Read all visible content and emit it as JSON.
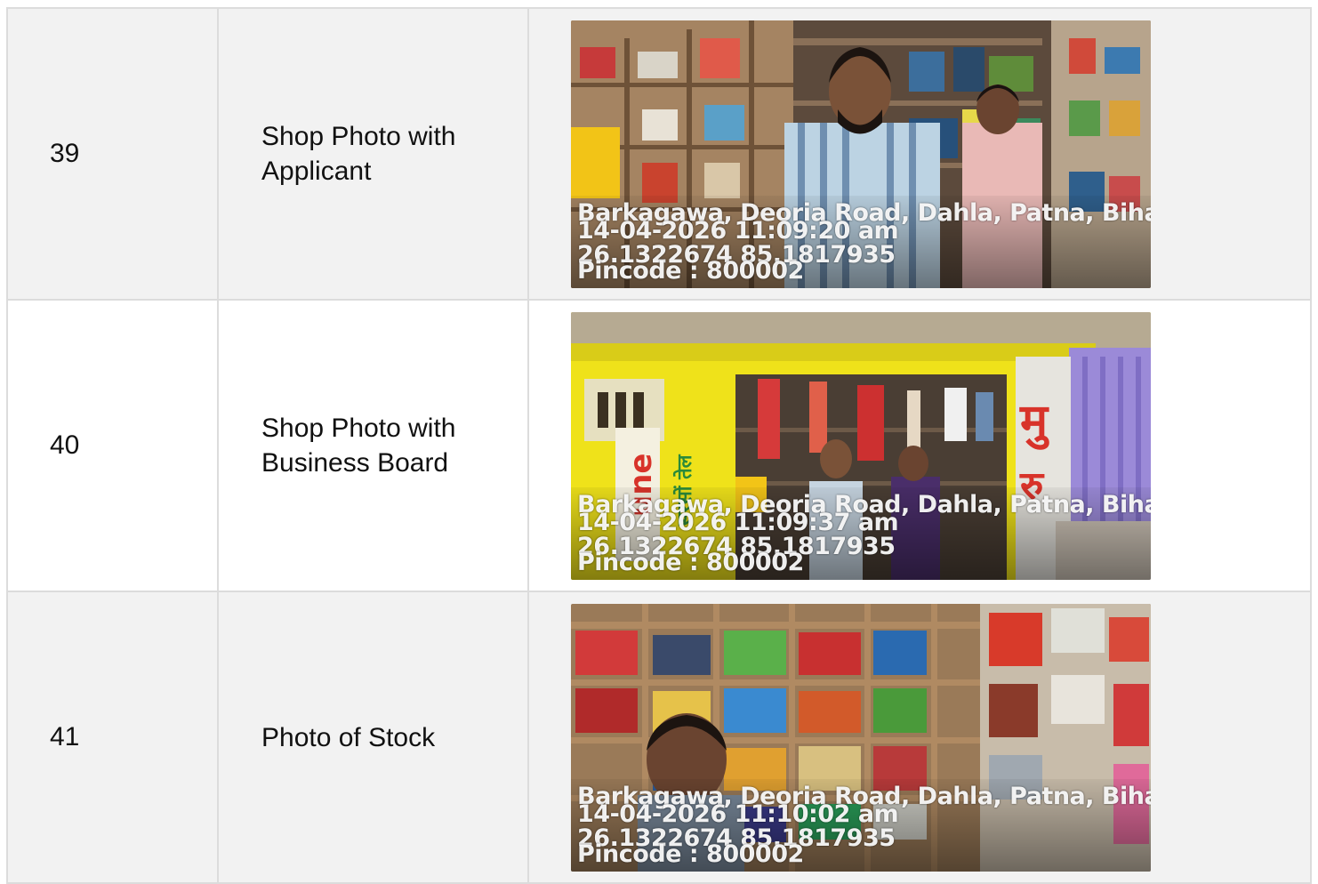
{
  "rows": [
    {
      "number": "39",
      "label": "Shop Photo with Applicant",
      "stamp": {
        "address": "Barkagawa, Deoria Road, Dahla, Patna, Bihar",
        "datetime": "14-04-2026 11:09:20 am",
        "coords": "26.1322674 85.1817935",
        "pincode": "Pincode : 800002"
      }
    },
    {
      "number": "40",
      "label": "Shop Photo with Business Board",
      "stamp": {
        "address": "Barkagawa, Deoria Road, Dahla, Patna, Bihar",
        "datetime": "14-04-2026 11:09:37 am",
        "coords": "26.1322674 85.1817935",
        "pincode": "Pincode : 800002"
      }
    },
    {
      "number": "41",
      "label": "Photo of Stock",
      "stamp": {
        "address": "Barkagawa, Deoria Road, Dahla, Patna, Bihar",
        "datetime": "14-04-2026 11:10:02 am",
        "coords": "26.1322674 85.1817935",
        "pincode": "Pincode : 800002"
      }
    }
  ]
}
